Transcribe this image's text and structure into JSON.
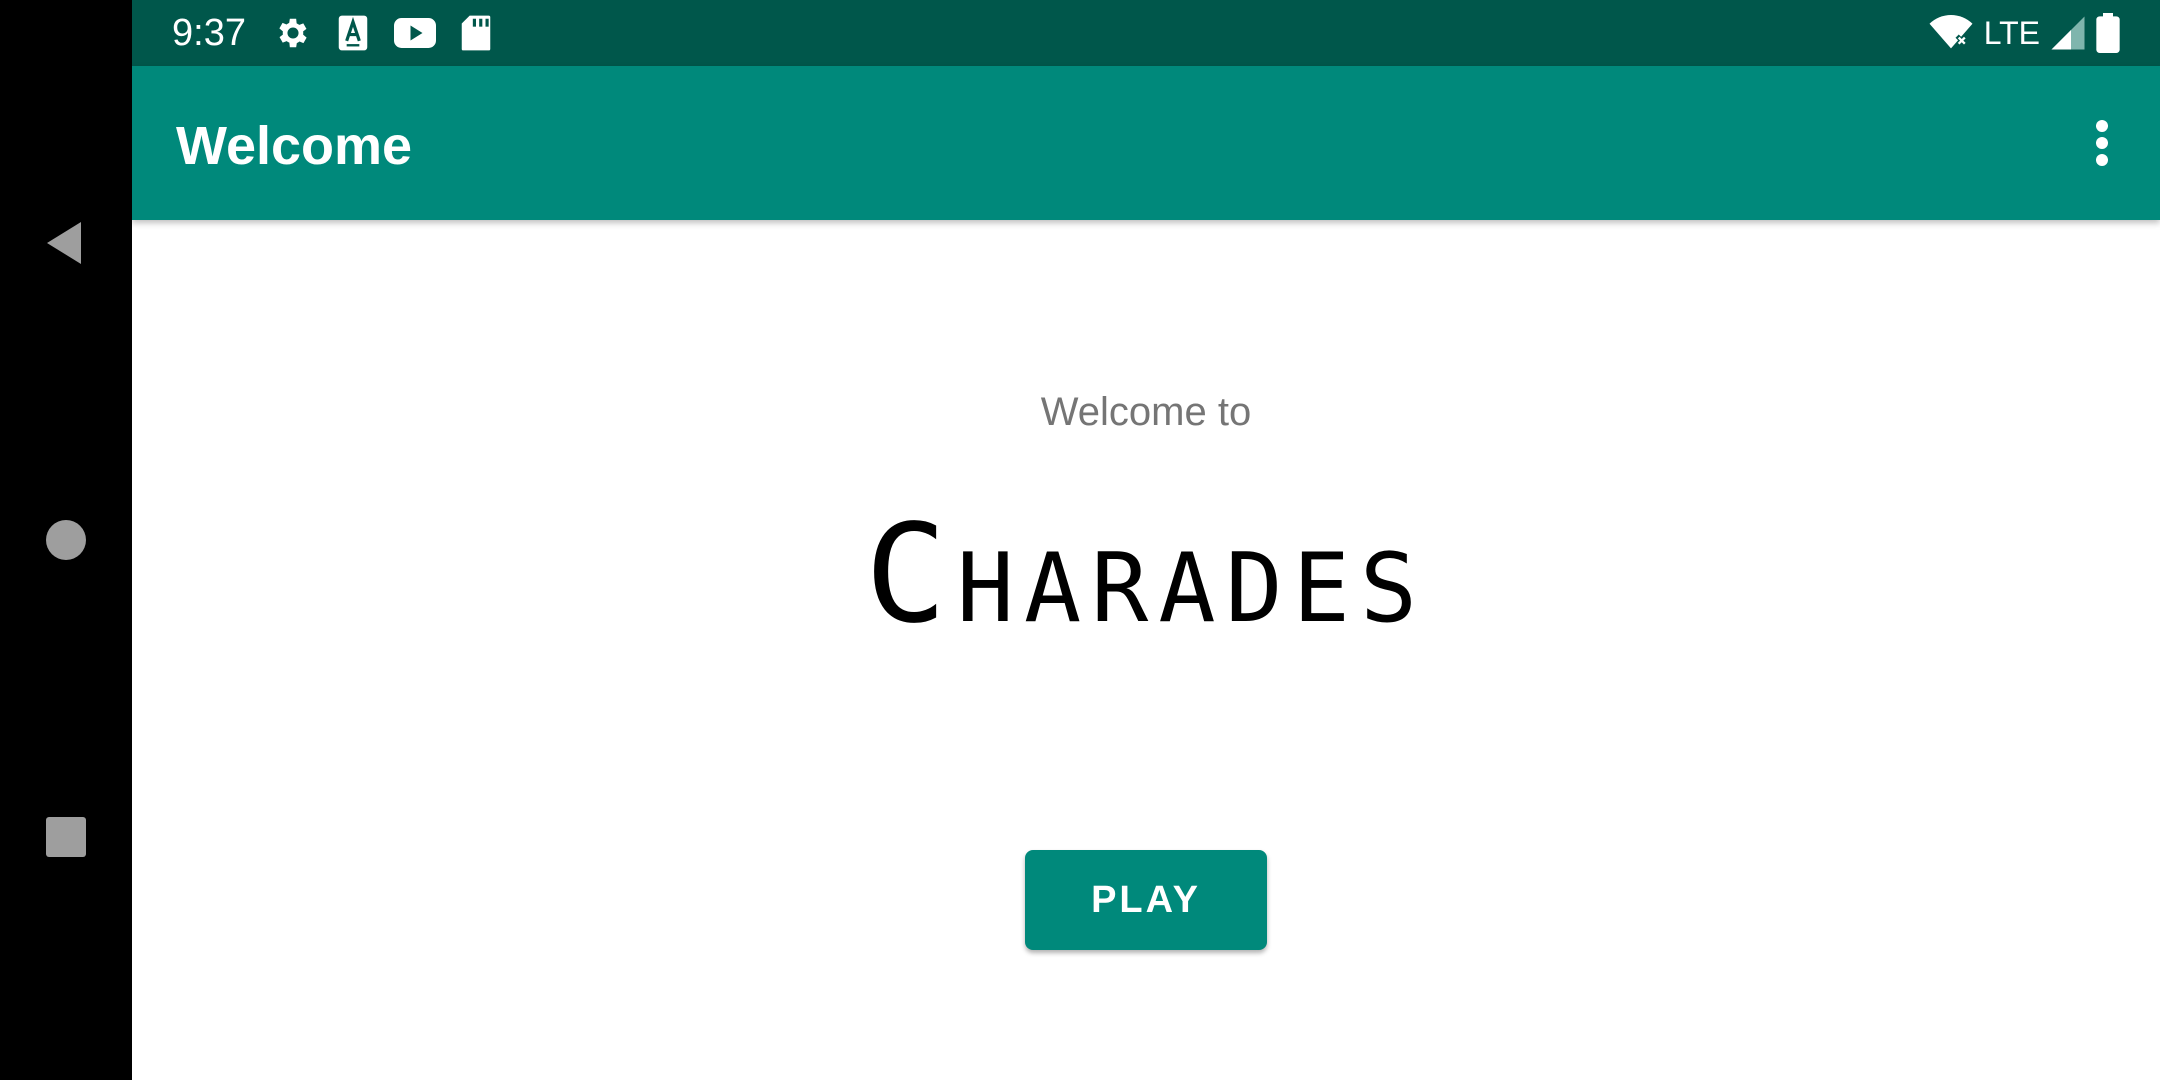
{
  "status_bar": {
    "time": "9:37",
    "network": "LTE",
    "icons": [
      "gear-icon",
      "text-a-icon",
      "youtube-icon",
      "sd-card-icon",
      "wifi-off-icon",
      "signal-icon",
      "battery-icon"
    ]
  },
  "app_bar": {
    "title": "Welcome",
    "overflow_icon": "more-vert-icon"
  },
  "main": {
    "subtitle": "Welcome to",
    "title": "Charades",
    "play_label": "PLAY"
  },
  "navigation": {
    "icons": [
      "back-triangle-icon",
      "home-circle-icon",
      "recents-square-icon"
    ]
  },
  "colors": {
    "status_bar": "#00574b",
    "primary": "#00897b",
    "background": "#ffffff",
    "subtitle_text": "#757575"
  }
}
